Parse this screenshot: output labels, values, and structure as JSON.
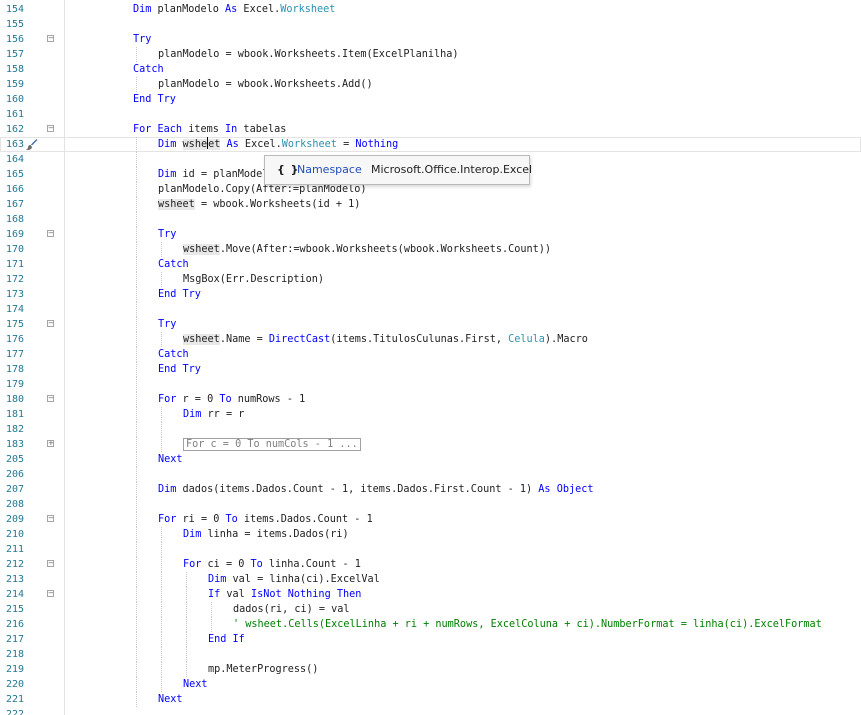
{
  "editor": {
    "lines": [
      {
        "n": "154",
        "ind": 0,
        "fold": "",
        "t": [
          {
            "c": "kw",
            "s": "Dim"
          },
          {
            "s": " planModelo "
          },
          {
            "c": "kw",
            "s": "As"
          },
          {
            "s": " Excel."
          },
          {
            "c": "ty",
            "s": "Worksheet"
          }
        ]
      },
      {
        "n": "155",
        "ind": 0,
        "fold": "",
        "t": []
      },
      {
        "n": "156",
        "ind": 0,
        "fold": "minus",
        "t": [
          {
            "c": "kw",
            "s": "Try"
          }
        ]
      },
      {
        "n": "157",
        "ind": 1,
        "fold": "",
        "t": [
          {
            "s": "planModelo = wbook.Worksheets.Item(ExcelPlanilha)"
          }
        ]
      },
      {
        "n": "158",
        "ind": 0,
        "fold": "",
        "t": [
          {
            "c": "kw",
            "s": "Catch"
          }
        ]
      },
      {
        "n": "159",
        "ind": 1,
        "fold": "",
        "t": [
          {
            "s": "planModelo = wbook.Worksheets.Add()"
          }
        ]
      },
      {
        "n": "160",
        "ind": 0,
        "fold": "",
        "t": [
          {
            "c": "kw",
            "s": "End Try"
          }
        ]
      },
      {
        "n": "161",
        "ind": 0,
        "fold": "",
        "t": []
      },
      {
        "n": "162",
        "ind": 0,
        "fold": "minus",
        "t": [
          {
            "c": "kw",
            "s": "For Each"
          },
          {
            "s": " items "
          },
          {
            "c": "kw",
            "s": "In"
          },
          {
            "s": " tabelas"
          }
        ]
      },
      {
        "n": "163",
        "ind": 1,
        "fold": "",
        "current": true,
        "brush": true,
        "t": [
          {
            "c": "kw",
            "s": "Dim"
          },
          {
            "s": " "
          },
          {
            "c": "hl",
            "s": "wshe"
          },
          {
            "caret": true
          },
          {
            "c": "hl",
            "s": "et"
          },
          {
            "s": " "
          },
          {
            "c": "kw",
            "s": "As"
          },
          {
            "s": " Excel."
          },
          {
            "c": "ty",
            "s": "Worksheet"
          },
          {
            "s": " = "
          },
          {
            "c": "kw",
            "s": "Nothing"
          }
        ]
      },
      {
        "n": "164",
        "ind": 1,
        "fold": "",
        "t": []
      },
      {
        "n": "165",
        "ind": 1,
        "fold": "",
        "t": [
          {
            "c": "kw",
            "s": "Dim"
          },
          {
            "s": " id = planModelo.Index"
          }
        ]
      },
      {
        "n": "166",
        "ind": 1,
        "fold": "",
        "t": [
          {
            "s": "planModelo.Copy(After:=planModelo)"
          }
        ]
      },
      {
        "n": "167",
        "ind": 1,
        "fold": "",
        "t": [
          {
            "c": "hl",
            "s": "wsheet"
          },
          {
            "s": " = wbook.Worksheets(id + 1)"
          }
        ]
      },
      {
        "n": "168",
        "ind": 1,
        "fold": "",
        "t": []
      },
      {
        "n": "169",
        "ind": 1,
        "fold": "minus",
        "t": [
          {
            "c": "kw",
            "s": "Try"
          }
        ]
      },
      {
        "n": "170",
        "ind": 2,
        "fold": "",
        "t": [
          {
            "c": "hl",
            "s": "wsheet"
          },
          {
            "s": ".Move(After:=wbook.Worksheets(wbook.Worksheets.Count))"
          }
        ]
      },
      {
        "n": "171",
        "ind": 1,
        "fold": "",
        "t": [
          {
            "c": "kw",
            "s": "Catch"
          }
        ]
      },
      {
        "n": "172",
        "ind": 2,
        "fold": "",
        "t": [
          {
            "s": "MsgBox(Err.Description)"
          }
        ]
      },
      {
        "n": "173",
        "ind": 1,
        "fold": "",
        "t": [
          {
            "c": "kw",
            "s": "End Try"
          }
        ]
      },
      {
        "n": "174",
        "ind": 1,
        "fold": "",
        "t": []
      },
      {
        "n": "175",
        "ind": 1,
        "fold": "minus",
        "t": [
          {
            "c": "kw",
            "s": "Try"
          }
        ]
      },
      {
        "n": "176",
        "ind": 2,
        "fold": "",
        "t": [
          {
            "c": "hl",
            "s": "wsheet"
          },
          {
            "s": ".Name = "
          },
          {
            "c": "kw",
            "s": "DirectCast"
          },
          {
            "s": "(items.TitulosCulunas.First, "
          },
          {
            "c": "ty",
            "s": "Celula"
          },
          {
            "s": ").Macro"
          }
        ]
      },
      {
        "n": "177",
        "ind": 1,
        "fold": "",
        "t": [
          {
            "c": "kw",
            "s": "Catch"
          }
        ]
      },
      {
        "n": "178",
        "ind": 1,
        "fold": "",
        "t": [
          {
            "c": "kw",
            "s": "End Try"
          }
        ]
      },
      {
        "n": "179",
        "ind": 1,
        "fold": "",
        "t": []
      },
      {
        "n": "180",
        "ind": 1,
        "fold": "minus",
        "t": [
          {
            "c": "kw",
            "s": "For"
          },
          {
            "s": " r = 0 "
          },
          {
            "c": "kw",
            "s": "To"
          },
          {
            "s": " numRows - 1"
          }
        ]
      },
      {
        "n": "181",
        "ind": 2,
        "fold": "",
        "t": [
          {
            "c": "kw",
            "s": "Dim"
          },
          {
            "s": " rr = r"
          }
        ]
      },
      {
        "n": "182",
        "ind": 2,
        "fold": "",
        "t": []
      },
      {
        "n": "183",
        "ind": 2,
        "fold": "plus",
        "t": [
          {
            "c": "collapsed",
            "s": "For c = 0 To numCols - 1 ..."
          }
        ]
      },
      {
        "n": "205",
        "ind": 1,
        "fold": "",
        "t": [
          {
            "c": "kw",
            "s": "Next"
          }
        ]
      },
      {
        "n": "206",
        "ind": 1,
        "fold": "",
        "t": []
      },
      {
        "n": "207",
        "ind": 1,
        "fold": "",
        "t": [
          {
            "c": "kw",
            "s": "Dim"
          },
          {
            "s": " dados(items.Dados.Count - 1, items.Dados.First.Count - 1) "
          },
          {
            "c": "kw",
            "s": "As"
          },
          {
            "s": " "
          },
          {
            "c": "kw",
            "s": "Object"
          }
        ]
      },
      {
        "n": "208",
        "ind": 1,
        "fold": "",
        "t": []
      },
      {
        "n": "209",
        "ind": 1,
        "fold": "minus",
        "t": [
          {
            "c": "kw",
            "s": "For"
          },
          {
            "s": " ri = 0 "
          },
          {
            "c": "kw",
            "s": "To"
          },
          {
            "s": " items.Dados.Count - 1"
          }
        ]
      },
      {
        "n": "210",
        "ind": 2,
        "fold": "",
        "t": [
          {
            "c": "kw",
            "s": "Dim"
          },
          {
            "s": " linha = items.Dados(ri)"
          }
        ]
      },
      {
        "n": "211",
        "ind": 2,
        "fold": "",
        "t": []
      },
      {
        "n": "212",
        "ind": 2,
        "fold": "minus",
        "t": [
          {
            "c": "kw",
            "s": "For"
          },
          {
            "s": " ci = 0 "
          },
          {
            "c": "kw",
            "s": "To"
          },
          {
            "s": " linha.Count - 1"
          }
        ]
      },
      {
        "n": "213",
        "ind": 3,
        "fold": "",
        "t": [
          {
            "c": "kw",
            "s": "Dim"
          },
          {
            "s": " val = linha(ci).ExcelVal"
          }
        ]
      },
      {
        "n": "214",
        "ind": 3,
        "fold": "minus",
        "t": [
          {
            "c": "kw",
            "s": "If"
          },
          {
            "s": " val "
          },
          {
            "c": "kw",
            "s": "IsNot"
          },
          {
            "s": " "
          },
          {
            "c": "kw",
            "s": "Nothing"
          },
          {
            "s": " "
          },
          {
            "c": "kw",
            "s": "Then"
          }
        ]
      },
      {
        "n": "215",
        "ind": 4,
        "fold": "",
        "t": [
          {
            "s": "dados(ri, ci) = val"
          }
        ]
      },
      {
        "n": "216",
        "ind": 4,
        "fold": "",
        "t": [
          {
            "c": "cm",
            "s": "' wsheet.Cells(ExcelLinha + ri + numRows, ExcelColuna + ci).NumberFormat = linha(ci).ExcelFormat"
          }
        ]
      },
      {
        "n": "217",
        "ind": 3,
        "fold": "",
        "t": [
          {
            "c": "kw",
            "s": "End If"
          }
        ]
      },
      {
        "n": "218",
        "ind": 3,
        "fold": "",
        "t": []
      },
      {
        "n": "219",
        "ind": 3,
        "fold": "",
        "t": [
          {
            "s": "mp.MeterProgress()"
          }
        ]
      },
      {
        "n": "220",
        "ind": 2,
        "fold": "",
        "t": [
          {
            "c": "kw",
            "s": "Next"
          }
        ]
      },
      {
        "n": "221",
        "ind": 1,
        "fold": "",
        "t": [
          {
            "c": "kw",
            "s": "Next"
          }
        ]
      },
      {
        "n": "222",
        "ind": 0,
        "fold": "",
        "t": []
      }
    ]
  },
  "tooltip": {
    "icon": "{ }",
    "kind": "Namespace",
    "name": "Microsoft.Office.Interop.Excel"
  },
  "colors": {
    "keyword": "#0000ff",
    "type": "#2b91af",
    "comment": "#008000",
    "line_number": "#237893"
  },
  "icons": {
    "quick_action": "paintbrush-icon",
    "fold_open": "collapse-minus-icon",
    "fold_closed": "expand-plus-icon"
  }
}
